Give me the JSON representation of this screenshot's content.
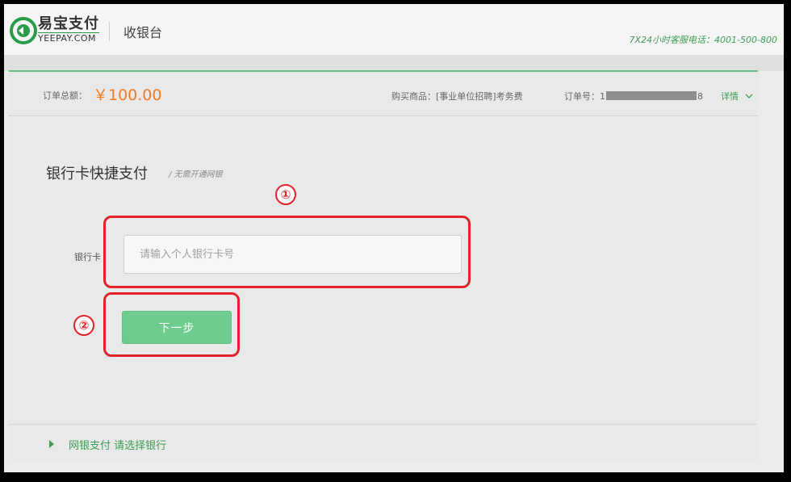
{
  "header": {
    "brand_cn": "易宝支付",
    "brand_en": "YEEPAY.COM",
    "page_title": "收银台",
    "hotline": "7X24小时客服电话：4001-500-800"
  },
  "order": {
    "total_label": "订单总额：",
    "total_value": "￥100.00",
    "product_label": "购买商品：[事业单位招聘]考务费",
    "order_no_prefix": "订单号：1",
    "order_no_suffix": "8",
    "detail_label": "详情"
  },
  "form": {
    "section_title": "银行卡快捷支付",
    "section_subtitle": "/ 无需开通网银",
    "card_label": "银行卡",
    "card_placeholder": "请输入个人银行卡号",
    "next_button": "下一步"
  },
  "footer": {
    "netbank_text": "网银支付 请选择银行"
  },
  "annotations": {
    "step1": "①",
    "step2": "②"
  },
  "colors": {
    "brand_green": "#3c9f55",
    "button_green": "#6fcc8f",
    "price_orange": "#ee7b22",
    "annotation_red": "#e5222a"
  }
}
